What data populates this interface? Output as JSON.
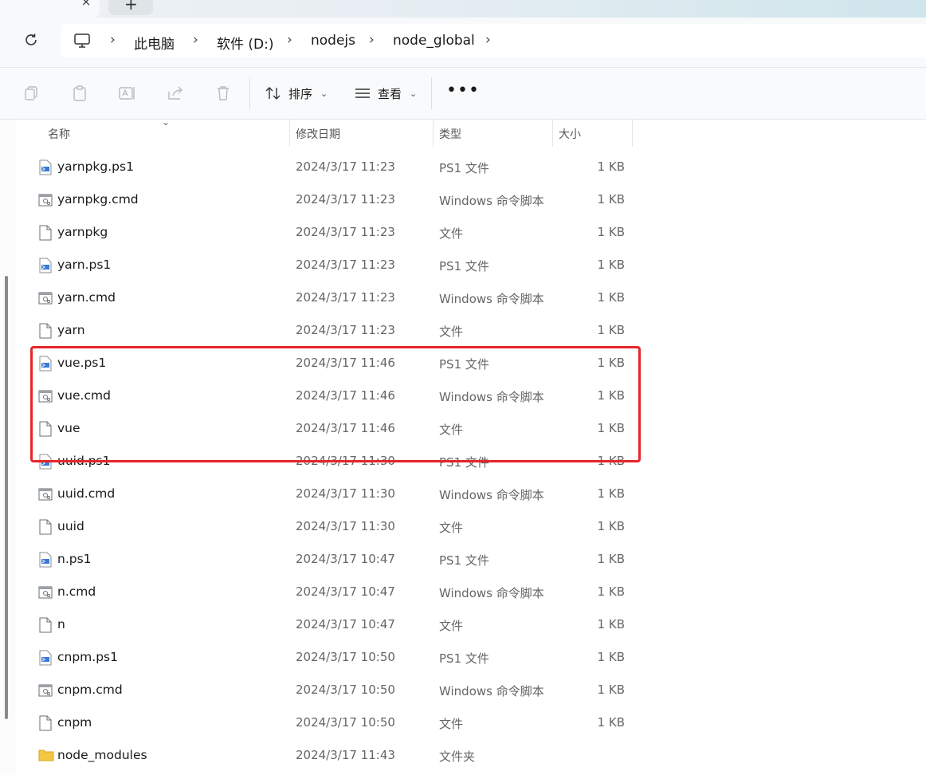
{
  "tabs": {
    "close_glyph": "×",
    "new_glyph": "+"
  },
  "breadcrumb": [
    {
      "label": "此电脑",
      "sep": "›"
    },
    {
      "label": "软件 (D:)",
      "sep": "›"
    },
    {
      "label": "nodejs",
      "sep": "›"
    },
    {
      "label": "node_global",
      "sep": "›"
    }
  ],
  "toolbar": {
    "sort_label": "排序",
    "view_label": "查看",
    "more_label": "•••"
  },
  "columns": {
    "name": "名称",
    "date": "修改日期",
    "type": "类型",
    "size": "大小"
  },
  "files": [
    {
      "name": "yarnpkg.ps1",
      "date": "2024/3/17 11:23",
      "type": "PS1 文件",
      "size": "1 KB",
      "icon": "ps1-file-icon"
    },
    {
      "name": "yarnpkg.cmd",
      "date": "2024/3/17 11:23",
      "type": "Windows 命令脚本",
      "size": "1 KB",
      "icon": "cmd-file-icon"
    },
    {
      "name": "yarnpkg",
      "date": "2024/3/17 11:23",
      "type": "文件",
      "size": "1 KB",
      "icon": "blank-file-icon"
    },
    {
      "name": "yarn.ps1",
      "date": "2024/3/17 11:23",
      "type": "PS1 文件",
      "size": "1 KB",
      "icon": "ps1-file-icon"
    },
    {
      "name": "yarn.cmd",
      "date": "2024/3/17 11:23",
      "type": "Windows 命令脚本",
      "size": "1 KB",
      "icon": "cmd-file-icon"
    },
    {
      "name": "yarn",
      "date": "2024/3/17 11:23",
      "type": "文件",
      "size": "1 KB",
      "icon": "blank-file-icon"
    },
    {
      "name": "vue.ps1",
      "date": "2024/3/17 11:46",
      "type": "PS1 文件",
      "size": "1 KB",
      "icon": "ps1-file-icon"
    },
    {
      "name": "vue.cmd",
      "date": "2024/3/17 11:46",
      "type": "Windows 命令脚本",
      "size": "1 KB",
      "icon": "cmd-file-icon"
    },
    {
      "name": "vue",
      "date": "2024/3/17 11:46",
      "type": "文件",
      "size": "1 KB",
      "icon": "blank-file-icon"
    },
    {
      "name": "uuid.ps1",
      "date": "2024/3/17 11:30",
      "type": "PS1 文件",
      "size": "1 KB",
      "icon": "ps1-file-icon"
    },
    {
      "name": "uuid.cmd",
      "date": "2024/3/17 11:30",
      "type": "Windows 命令脚本",
      "size": "1 KB",
      "icon": "cmd-file-icon"
    },
    {
      "name": "uuid",
      "date": "2024/3/17 11:30",
      "type": "文件",
      "size": "1 KB",
      "icon": "blank-file-icon"
    },
    {
      "name": "n.ps1",
      "date": "2024/3/17 10:47",
      "type": "PS1 文件",
      "size": "1 KB",
      "icon": "ps1-file-icon"
    },
    {
      "name": "n.cmd",
      "date": "2024/3/17 10:47",
      "type": "Windows 命令脚本",
      "size": "1 KB",
      "icon": "cmd-file-icon"
    },
    {
      "name": "n",
      "date": "2024/3/17 10:47",
      "type": "文件",
      "size": "1 KB",
      "icon": "blank-file-icon"
    },
    {
      "name": "cnpm.ps1",
      "date": "2024/3/17 10:50",
      "type": "PS1 文件",
      "size": "1 KB",
      "icon": "ps1-file-icon"
    },
    {
      "name": "cnpm.cmd",
      "date": "2024/3/17 10:50",
      "type": "Windows 命令脚本",
      "size": "1 KB",
      "icon": "cmd-file-icon"
    },
    {
      "name": "cnpm",
      "date": "2024/3/17 10:50",
      "type": "文件",
      "size": "1 KB",
      "icon": "blank-file-icon"
    },
    {
      "name": "node_modules",
      "date": "2024/3/17 11:43",
      "type": "文件夹",
      "size": "",
      "icon": "folder-icon"
    }
  ],
  "highlight_color": "#e5262a"
}
